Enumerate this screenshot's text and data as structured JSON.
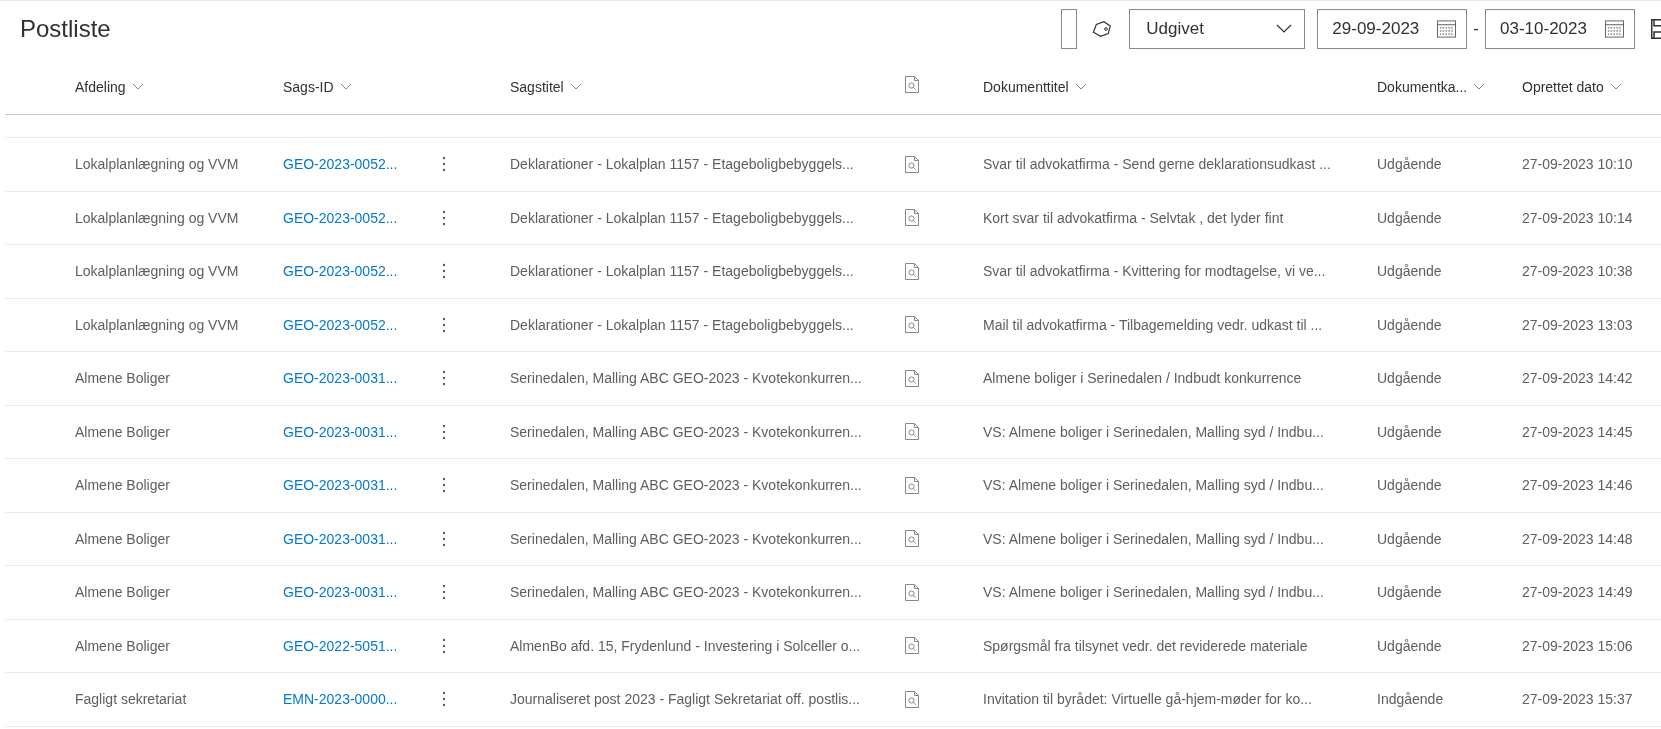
{
  "page_title": "Postliste",
  "toolbar": {
    "status_dropdown": {
      "value": "Udgivet"
    },
    "date_from": {
      "value": "29-09-2023"
    },
    "date_separator": "-",
    "date_to": {
      "value": "03-10-2023"
    }
  },
  "columns": [
    {
      "kind": "sortable",
      "label": "Afdeling"
    },
    {
      "kind": "sortable",
      "label": "Sags-ID"
    },
    {
      "kind": "blank"
    },
    {
      "kind": "sortable",
      "label": "Sagstitel"
    },
    {
      "kind": "icon"
    },
    {
      "kind": "sortable",
      "label": "Dokumenttitel"
    },
    {
      "kind": "sortable",
      "label": "Dokumentka..."
    },
    {
      "kind": "sortable",
      "label": "Oprettet dato"
    }
  ],
  "rows": [
    {
      "afdeling": "Lokalplanlægning og VVM",
      "sags_id": "GEO-2023-0052...",
      "sagstitel": "Deklarationer - Lokalplan 1157 - Etageboligbebyggels...",
      "dokumenttitel": "Svar til advokatfirma - Send gerne deklarationsudkast ...",
      "dokumentkategori": "Udgående",
      "oprettet_dato": "27-09-2023 10:10"
    },
    {
      "afdeling": "Lokalplanlægning og VVM",
      "sags_id": "GEO-2023-0052...",
      "sagstitel": "Deklarationer - Lokalplan 1157 - Etageboligbebyggels...",
      "dokumenttitel": "Kort svar til advokatfirma - Selvtak , det lyder fint",
      "dokumentkategori": "Udgående",
      "oprettet_dato": "27-09-2023 10:14"
    },
    {
      "afdeling": "Lokalplanlægning og VVM",
      "sags_id": "GEO-2023-0052...",
      "sagstitel": "Deklarationer - Lokalplan 1157 - Etageboligbebyggels...",
      "dokumenttitel": "Svar til advokatfirma - Kvittering for modtagelse, vi ve...",
      "dokumentkategori": "Udgående",
      "oprettet_dato": "27-09-2023 10:38"
    },
    {
      "afdeling": "Lokalplanlægning og VVM",
      "sags_id": "GEO-2023-0052...",
      "sagstitel": "Deklarationer - Lokalplan 1157 - Etageboligbebyggels...",
      "dokumenttitel": "Mail til advokatfirma - Tilbagemelding vedr. udkast til ...",
      "dokumentkategori": "Udgående",
      "oprettet_dato": "27-09-2023 13:03"
    },
    {
      "afdeling": "Almene Boliger",
      "sags_id": "GEO-2023-0031...",
      "sagstitel": "Serinedalen, Malling ABC GEO-2023 - Kvotekonkurren...",
      "dokumenttitel": "Almene boliger i Serinedalen / Indbudt konkurrence",
      "dokumentkategori": "Udgående",
      "oprettet_dato": "27-09-2023 14:42"
    },
    {
      "afdeling": "Almene Boliger",
      "sags_id": "GEO-2023-0031...",
      "sagstitel": "Serinedalen, Malling ABC GEO-2023 - Kvotekonkurren...",
      "dokumenttitel": "VS: Almene boliger i Serinedalen, Malling syd / Indbu...",
      "dokumentkategori": "Udgående",
      "oprettet_dato": "27-09-2023 14:45"
    },
    {
      "afdeling": "Almene Boliger",
      "sags_id": "GEO-2023-0031...",
      "sagstitel": "Serinedalen, Malling ABC GEO-2023 - Kvotekonkurren...",
      "dokumenttitel": "VS: Almene boliger i Serinedalen, Malling syd / Indbu...",
      "dokumentkategori": "Udgående",
      "oprettet_dato": "27-09-2023 14:46"
    },
    {
      "afdeling": "Almene Boliger",
      "sags_id": "GEO-2023-0031...",
      "sagstitel": "Serinedalen, Malling ABC GEO-2023 - Kvotekonkurren...",
      "dokumenttitel": "VS: Almene boliger i Serinedalen, Malling syd / Indbu...",
      "dokumentkategori": "Udgående",
      "oprettet_dato": "27-09-2023 14:48"
    },
    {
      "afdeling": "Almene Boliger",
      "sags_id": "GEO-2023-0031...",
      "sagstitel": "Serinedalen, Malling ABC GEO-2023 - Kvotekonkurren...",
      "dokumenttitel": "VS: Almene boliger i Serinedalen, Malling syd / Indbu...",
      "dokumentkategori": "Udgående",
      "oprettet_dato": "27-09-2023 14:49"
    },
    {
      "afdeling": "Almene Boliger",
      "sags_id": "GEO-2022-5051...",
      "sagstitel": "AlmenBo afd. 15, Frydenlund - Investering i Solceller o...",
      "dokumenttitel": "Spørgsmål fra tilsynet vedr. det reviderede materiale",
      "dokumentkategori": "Udgående",
      "oprettet_dato": "27-09-2023 15:06"
    },
    {
      "afdeling": "Fagligt sekretariat",
      "sags_id": "EMN-2023-0000...",
      "sagstitel": "Journaliseret post 2023 - Fagligt Sekretariat off. postlis...",
      "dokumenttitel": "Invitation til byrådet: Virtuelle gå-hjem-møder for ko...",
      "dokumentkategori": "Indgående",
      "oprettet_dato": "27-09-2023 15:37"
    }
  ]
}
